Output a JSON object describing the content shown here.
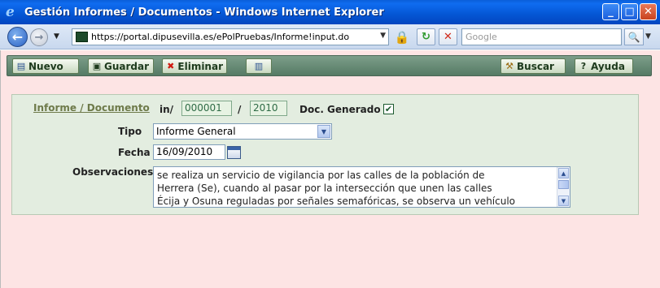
{
  "window": {
    "title": "Gestión Informes / Documentos - Windows Internet Explorer",
    "app_icon": "e",
    "controls": {
      "minimize": "_",
      "maximize": "□",
      "close": "✕"
    }
  },
  "browser": {
    "back": "←",
    "forward": "→",
    "history_dropdown": "▼",
    "url": "https://portal.dipusevilla.es/ePolPruebas/Informe!input.do",
    "url_dropdown": "▼",
    "lock": "🔒",
    "refresh": "↻",
    "stop": "✕",
    "search_placeholder": "Google",
    "search_button": "🔍",
    "search_dropdown": "▼"
  },
  "toolbar": {
    "nuevo_icon": "▤",
    "nuevo": "Nuevo",
    "guardar_icon": "▣",
    "guardar": "Guardar",
    "eliminar_icon": "✖",
    "eliminar": "Eliminar",
    "print_icon": "▥",
    "buscar_icon": "⚒",
    "buscar": "Buscar",
    "ayuda_icon": "?",
    "ayuda": "Ayuda"
  },
  "form": {
    "title_link": "Informe / Documento",
    "in_label": "in/",
    "number": "000001",
    "separator": "/",
    "year": "2010",
    "doc_generado_label": "Doc. Generado",
    "doc_generado_checked": "✔",
    "tipo_label": "Tipo",
    "tipo_value": "Informe General",
    "select_arrow": "▼",
    "fecha_label": "Fecha",
    "fecha_value": "16/09/2010",
    "observaciones_label": "Observaciones",
    "observaciones_lines": [
      "se realiza un servicio de vigilancia por las calles de la población de",
      "Herrera (Se), cuando al pasar por la intersección que unen las calles",
      "Écija y Osuna reguladas por señales semafóricas, se observa un vehículo"
    ],
    "scroll_up": "▲",
    "scroll_down": "▼"
  }
}
